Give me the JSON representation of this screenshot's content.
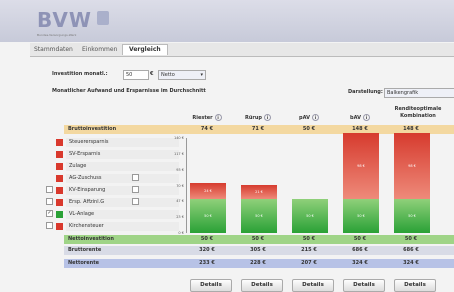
{
  "header": {
    "logo": "BVW",
    "subtitle": "Bundes-Versorgungs-Werk"
  },
  "tabs": [
    {
      "label": "Stammdaten"
    },
    {
      "label": "Einkommen"
    },
    {
      "label": "Vergleich"
    }
  ],
  "form": {
    "investment_label": "Investition monatl.:",
    "investment_value": "50",
    "currency": "€",
    "mode_value": "Netto",
    "section_title": "Monatlicher Aufwand und Ersparnisse im Durchschnitt",
    "display_label": "Darstellung:",
    "display_value": "Balkengrafik"
  },
  "columns": [
    {
      "name": "Riester"
    },
    {
      "name": "Rürup"
    },
    {
      "name": "pAV"
    },
    {
      "name": "bAV"
    },
    {
      "name": "Renditeoptimale Kombination"
    }
  ],
  "rows": {
    "brutto": {
      "label": "Bruttoinvestition",
      "values": [
        "74 €",
        "71 €",
        "50 €",
        "148 €",
        "148 €"
      ]
    },
    "netto": {
      "label": "Nettoinvestition",
      "values": [
        "50 €",
        "50 €",
        "50 €",
        "50 €",
        "50 €"
      ]
    },
    "bruttorente": {
      "label": "Bruttorente",
      "values": [
        "320 €",
        "305 €",
        "215 €",
        "686 €",
        "686 €"
      ]
    },
    "nettorente": {
      "label": "Nettorente",
      "values": [
        "233 €",
        "228 €",
        "207 €",
        "324 €",
        "324 €"
      ]
    }
  },
  "legend": [
    {
      "label": "Steuerersparnis",
      "color": "#d9392d"
    },
    {
      "label": "SV-Ersparnis",
      "color": "#d9392d"
    },
    {
      "label": "Zulage",
      "color": "#d9392d"
    },
    {
      "label": "AG-Zuschuss",
      "color": "#d9392d"
    },
    {
      "label": "KV-Einsparung",
      "color": "#d9392d"
    },
    {
      "label": "Ersp. Affzinl.G",
      "color": "#d9392d"
    },
    {
      "label": "VL-Anlage",
      "color": "#2aa136"
    },
    {
      "label": "Kirchensteuer",
      "color": "#d9392d"
    }
  ],
  "chart_data": {
    "type": "bar",
    "categories": [
      "Riester",
      "Rürup",
      "pAV",
      "bAV",
      "Renditeoptimale Kombination"
    ],
    "series": [
      {
        "values": [
          50,
          50,
          50,
          50,
          50
        ]
      },
      {
        "values": [
          24,
          21,
          0,
          98,
          98
        ]
      }
    ],
    "ylim": [
      0,
      140
    ],
    "yticks": [
      "0 €",
      "23 €",
      "47 €",
      "70 €",
      "93 €",
      "117 €",
      "140 €"
    ],
    "bar_labels_green": [
      "50 €",
      "50 €",
      "50 €",
      "50 €",
      "50 €"
    ],
    "bar_labels_red": [
      "24 €",
      "21 €",
      "",
      "98 €",
      "98 €"
    ]
  },
  "buttons": {
    "details": "Details"
  }
}
